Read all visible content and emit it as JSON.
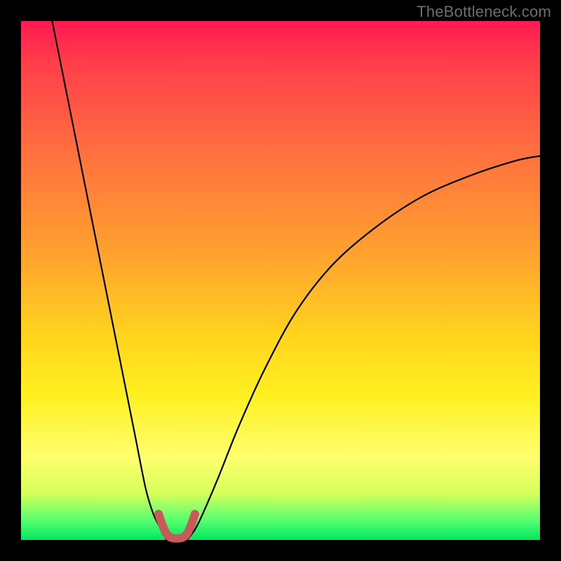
{
  "watermark": "TheBottleneck.com",
  "colors": {
    "page_bg": "#000000",
    "curve_stroke": "#000000",
    "marker_stroke": "#c85a5a",
    "gradient_top": "#ff1a52",
    "gradient_bottom": "#00e85e"
  },
  "chart_data": {
    "type": "line",
    "title": "",
    "xlabel": "",
    "ylabel": "",
    "xlim": [
      0,
      100
    ],
    "ylim": [
      0,
      100
    ],
    "grid": false,
    "legend": false,
    "annotations": [],
    "series": [
      {
        "name": "left-curve",
        "x": [
          6,
          8,
          10,
          12,
          14,
          16,
          18,
          20,
          22,
          24,
          25.5,
          27,
          28
        ],
        "values": [
          100,
          90,
          80,
          70,
          60,
          50,
          40,
          30,
          20,
          10,
          5,
          2,
          0
        ]
      },
      {
        "name": "right-curve",
        "x": [
          32,
          33.5,
          35,
          38,
          42,
          47,
          53,
          60,
          68,
          77,
          86,
          95,
          100
        ],
        "values": [
          0,
          2,
          5,
          12,
          22,
          33,
          44,
          53,
          60,
          66,
          70,
          73,
          74
        ]
      },
      {
        "name": "marker-u",
        "x": [
          26.5,
          27.2,
          28,
          28.8,
          30,
          31.2,
          32,
          32.8,
          33.5
        ],
        "values": [
          5,
          3,
          1.2,
          0.5,
          0.3,
          0.5,
          1.2,
          3,
          5
        ]
      }
    ]
  }
}
